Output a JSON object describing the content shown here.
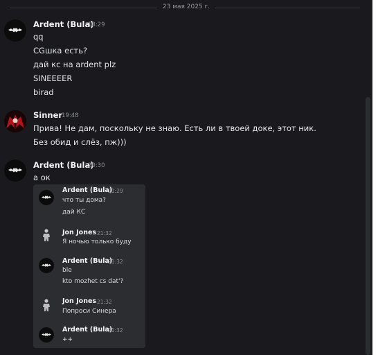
{
  "date_divider": "23 мая 2025 г.",
  "messages": [
    {
      "author": "Ardent (Bula)",
      "time": "18:29",
      "avatar": "bat-logo-icon",
      "lines": [
        "qq",
        "CGшка есть?",
        "дай кс на ardent plz",
        "SINEEEER",
        "birad"
      ]
    },
    {
      "author": "Sinner",
      "time": "19:48",
      "avatar": "red-winged-figure-avatar",
      "lines": [
        "Прива! Не дам, поскольку не знаю. Есть ли в твоей доке, этот ник.",
        "Без обид и слёз, пж)))"
      ]
    },
    {
      "author": "Ardent (Bula)",
      "time": "20:30",
      "avatar": "bat-logo-icon",
      "lines": [
        "а ок"
      ]
    }
  ],
  "forwarded": [
    {
      "author": "Ardent (Bula)",
      "time": "21:29",
      "avatar": "bat-logo-icon",
      "lines": [
        "что ты дома?",
        "дай КС"
      ]
    },
    {
      "author": "Jon Jones",
      "time": "21:32",
      "avatar": "fighter-avatar",
      "lines": [
        "Я ночью только буду"
      ]
    },
    {
      "author": "Ardent (Bula)",
      "time": "21:32",
      "avatar": "bat-logo-icon",
      "lines": [
        "ble",
        "kto mozhet cs dat'?"
      ]
    },
    {
      "author": "Jon Jones",
      "time": "21:32",
      "avatar": "fighter-avatar",
      "lines": [
        "Попроси Синера"
      ]
    },
    {
      "author": "Ardent (Bula)",
      "time": "21:32",
      "avatar": "bat-logo-icon",
      "lines": [
        "++"
      ]
    }
  ],
  "colors": {
    "background": "#1a1a1e",
    "embed_background": "#2b2d31",
    "username": "#f2f3f5",
    "timestamp": "#8e9297"
  }
}
